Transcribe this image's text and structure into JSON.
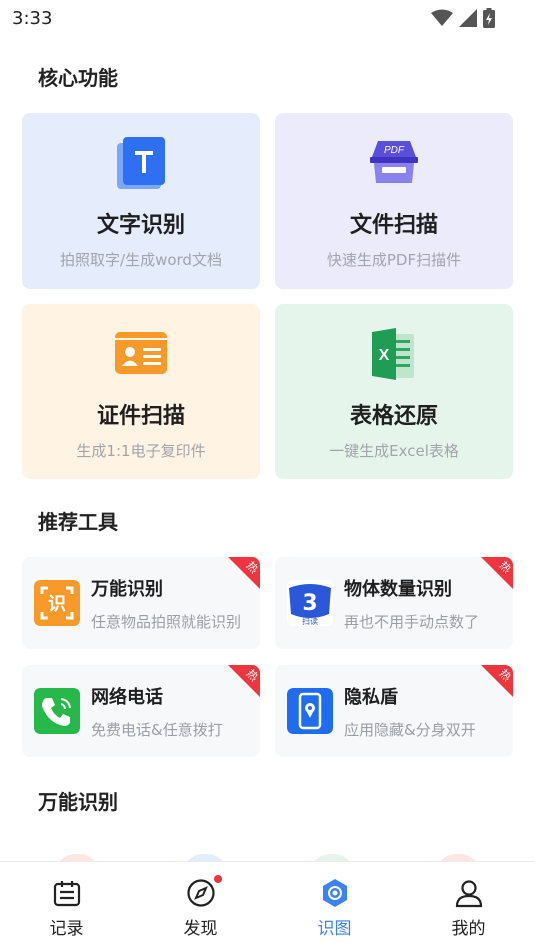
{
  "status_bar": {
    "time": "3:33"
  },
  "sections": {
    "core": "核心功能",
    "tools": "推荐工具",
    "universal": "万能识别"
  },
  "core_cards": [
    {
      "title": "文字识别",
      "subtitle": "拍照取字/生成word文档",
      "icon": "text-recognition-icon",
      "bg": "#e5edfd"
    },
    {
      "title": "文件扫描",
      "subtitle": "快速生成PDF扫描件",
      "icon": "pdf-scan-icon",
      "icon_text": "PDF",
      "bg": "#ecebfc"
    },
    {
      "title": "证件扫描",
      "subtitle": "生成1:1电子复印件",
      "icon": "id-card-icon",
      "bg": "#fff3e3"
    },
    {
      "title": "表格还原",
      "subtitle": "一键生成Excel表格",
      "icon": "excel-icon",
      "icon_text": "X",
      "bg": "#e6f5ec"
    }
  ],
  "tools": [
    {
      "title": "万能识别",
      "subtitle": "任意物品拍照就能识别",
      "icon": "universal-recognition-icon",
      "icon_text": "识",
      "hot": "热"
    },
    {
      "title": "物体数量识别",
      "subtitle": "再也不用手动点数了",
      "icon": "object-count-icon",
      "icon_text": "扫读",
      "hot": "热"
    },
    {
      "title": "网络电话",
      "subtitle": "免费电话&任意拨打",
      "icon": "phone-icon",
      "hot": "热"
    },
    {
      "title": "隐私盾",
      "subtitle": "应用隐藏&分身双开",
      "icon": "privacy-shield-icon",
      "hot": "热"
    }
  ],
  "tabs": [
    {
      "label": "记录",
      "icon": "record-icon",
      "active": false
    },
    {
      "label": "发现",
      "icon": "compass-icon",
      "active": false,
      "badge": true
    },
    {
      "label": "识图",
      "icon": "scan-image-icon",
      "active": true
    },
    {
      "label": "我的",
      "icon": "profile-icon",
      "active": false
    }
  ],
  "colors": {
    "accent": "#3b82f6",
    "hot_red": "#f0353f",
    "orange": "#f79a2a",
    "green": "#27b84a"
  }
}
